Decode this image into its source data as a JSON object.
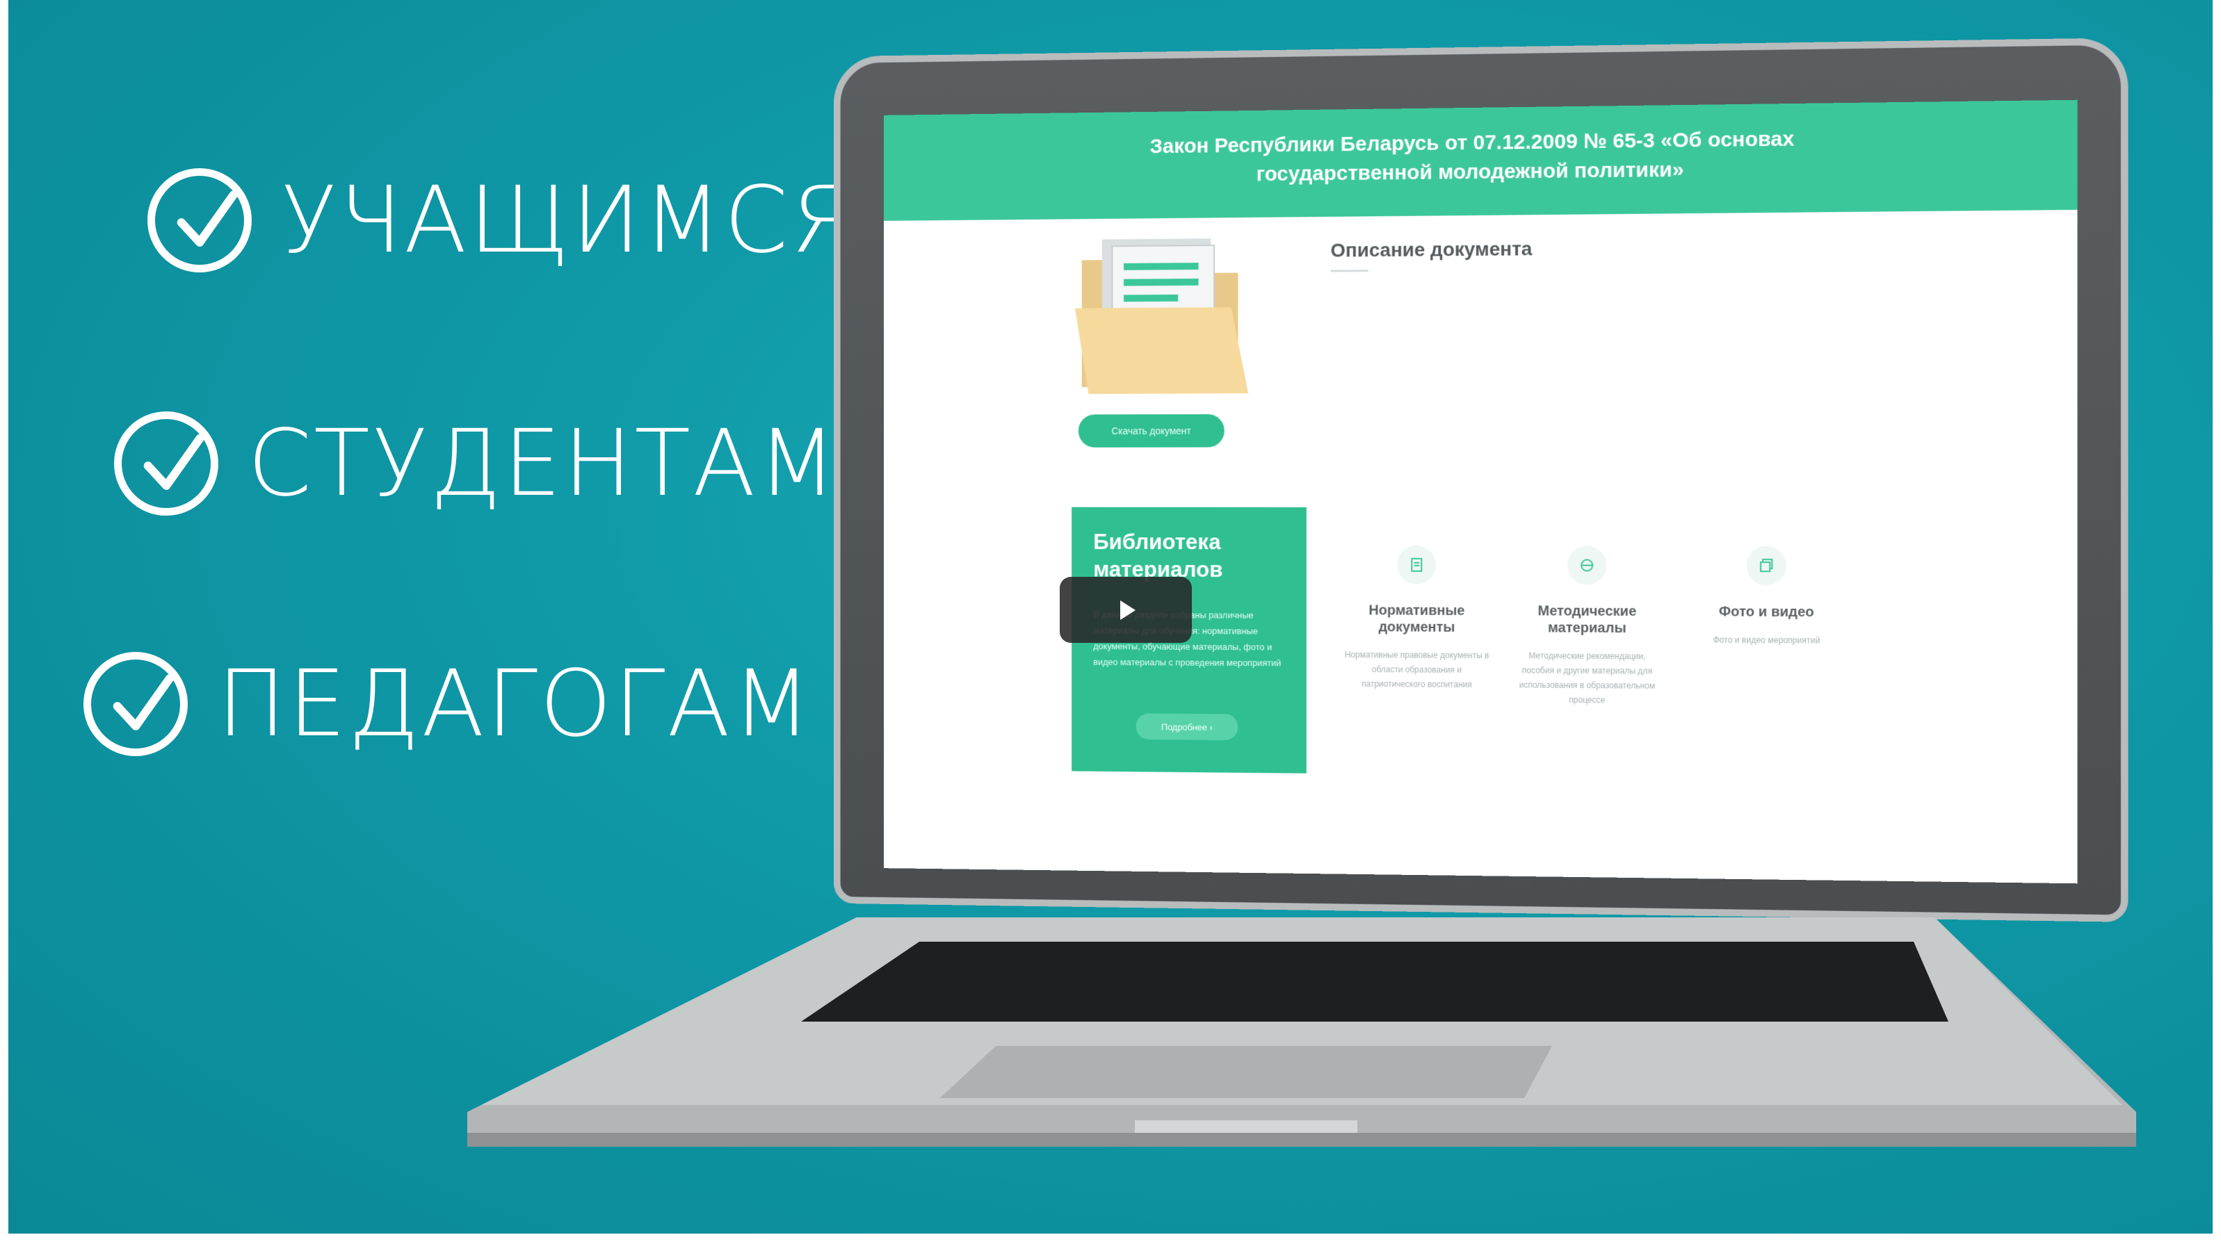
{
  "audience": {
    "items": [
      {
        "label": "УЧАЩИМСЯ"
      },
      {
        "label": "СТУДЕНТАМ"
      },
      {
        "label": "ПЕДАГОГАМ"
      }
    ]
  },
  "screen": {
    "header_line1": "Закон Республики Беларусь от 07.12.2009 № 65-3 «Об основах",
    "header_line2": "государственной молодежной политики»",
    "description_title": "Описание документа",
    "download_button": "Скачать документ",
    "library": {
      "title": "Библиотека материалов",
      "text": "В данном разделе собраны различные материалы для обучения: нормативные документы, обучающие материалы, фото и видео материалы с проведения мероприятий",
      "more_button": "Подробнее ›"
    },
    "categories": [
      {
        "title": "Нормативные документы",
        "desc": "Нормативные правовые документы в области образования и патриотического воспитания",
        "icon": "document-icon"
      },
      {
        "title": "Методические материалы",
        "desc": "Методические рекомендации, пособия и другие материалы для использования в образовательном процессе",
        "icon": "methodology-icon"
      },
      {
        "title": "Фото и видео",
        "desc": "Фото и видео мероприятий",
        "icon": "photo-icon"
      }
    ]
  },
  "colors": {
    "background": "#0f98a6",
    "accent": "#3cc79a",
    "card": "#2fbf90"
  }
}
